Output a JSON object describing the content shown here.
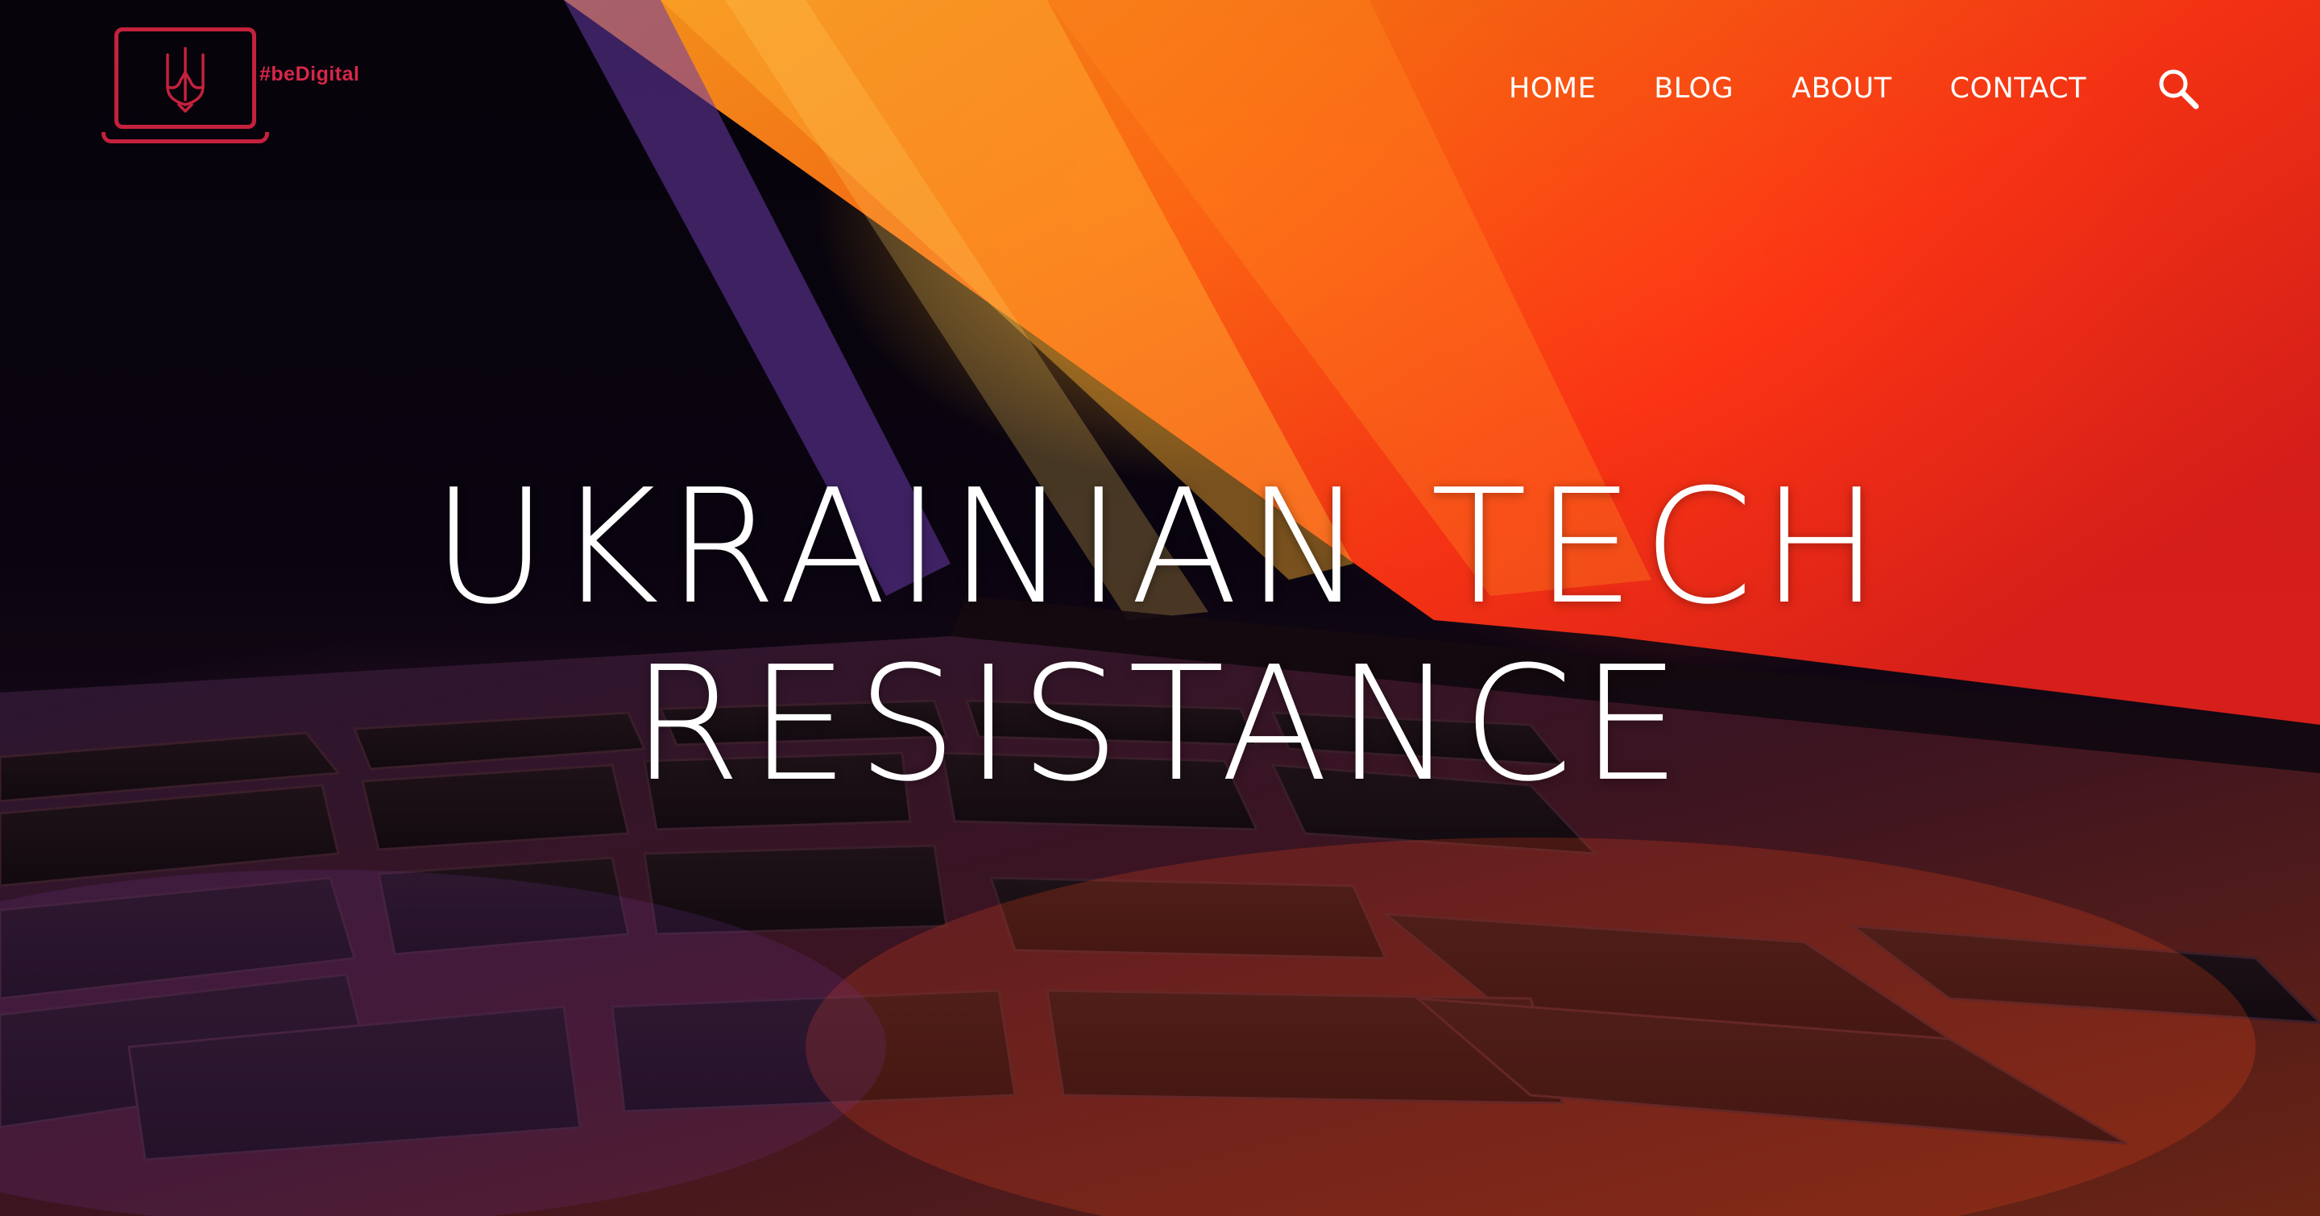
{
  "header": {
    "logo": {
      "tagline": "#beDigital",
      "icon": "laptop-trident-icon",
      "brand_color": "#c4213d"
    },
    "nav": [
      {
        "label": "HOME"
      },
      {
        "label": "BLOG"
      },
      {
        "label": "ABOUT"
      },
      {
        "label": "CONTACT"
      }
    ],
    "search_icon": "search-icon"
  },
  "hero": {
    "title_line_1": "UKRAINIAN TECH",
    "title_line_2": "RESISTANCE",
    "background": "laptop-keyboard-photo"
  }
}
